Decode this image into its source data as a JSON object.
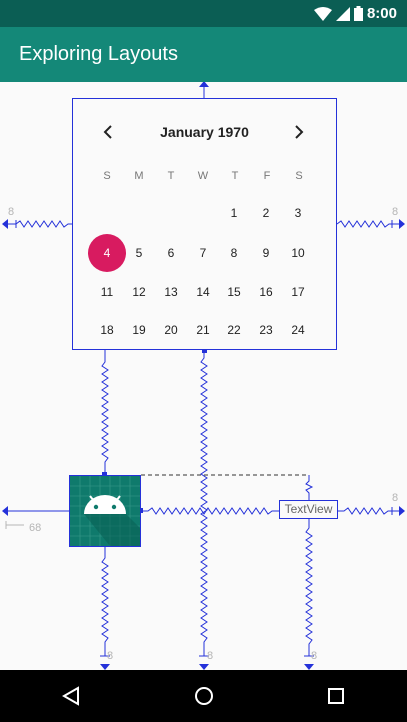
{
  "status_bar": {
    "time": "8:00"
  },
  "app_bar": {
    "title": "Exploring Layouts"
  },
  "calendar": {
    "month_label": "January 1970",
    "weekdays": [
      "S",
      "M",
      "T",
      "W",
      "T",
      "F",
      "S"
    ],
    "days": [
      "1",
      "2",
      "3",
      "4",
      "5",
      "6",
      "7",
      "8",
      "9",
      "10",
      "11",
      "12",
      "13",
      "14",
      "15",
      "16",
      "17",
      "18",
      "19",
      "20",
      "21",
      "22",
      "23",
      "24"
    ],
    "selected_day": "4",
    "selected_color": "#d81b60"
  },
  "textview": {
    "text": "TextView"
  },
  "margins": {
    "calendar_left": "8",
    "calendar_right": "8",
    "textview_right": "8",
    "image_start": "68",
    "image_bottom": "8",
    "middle_bottom": "8",
    "textview_bottom": "8"
  },
  "icons": {
    "wifi": "wifi-icon",
    "signal": "cellular-signal-icon",
    "battery": "battery-icon",
    "prev": "chevron-left-icon",
    "next": "chevron-right-icon",
    "back": "back-triangle-icon",
    "home": "home-circle-icon",
    "recents": "recents-square-icon",
    "image": "android-robot-icon"
  },
  "colors": {
    "status_bar": "#0b5e54",
    "app_bar": "#148878",
    "constraint": "#2431d9",
    "image_bg": "#0f7a6c"
  }
}
